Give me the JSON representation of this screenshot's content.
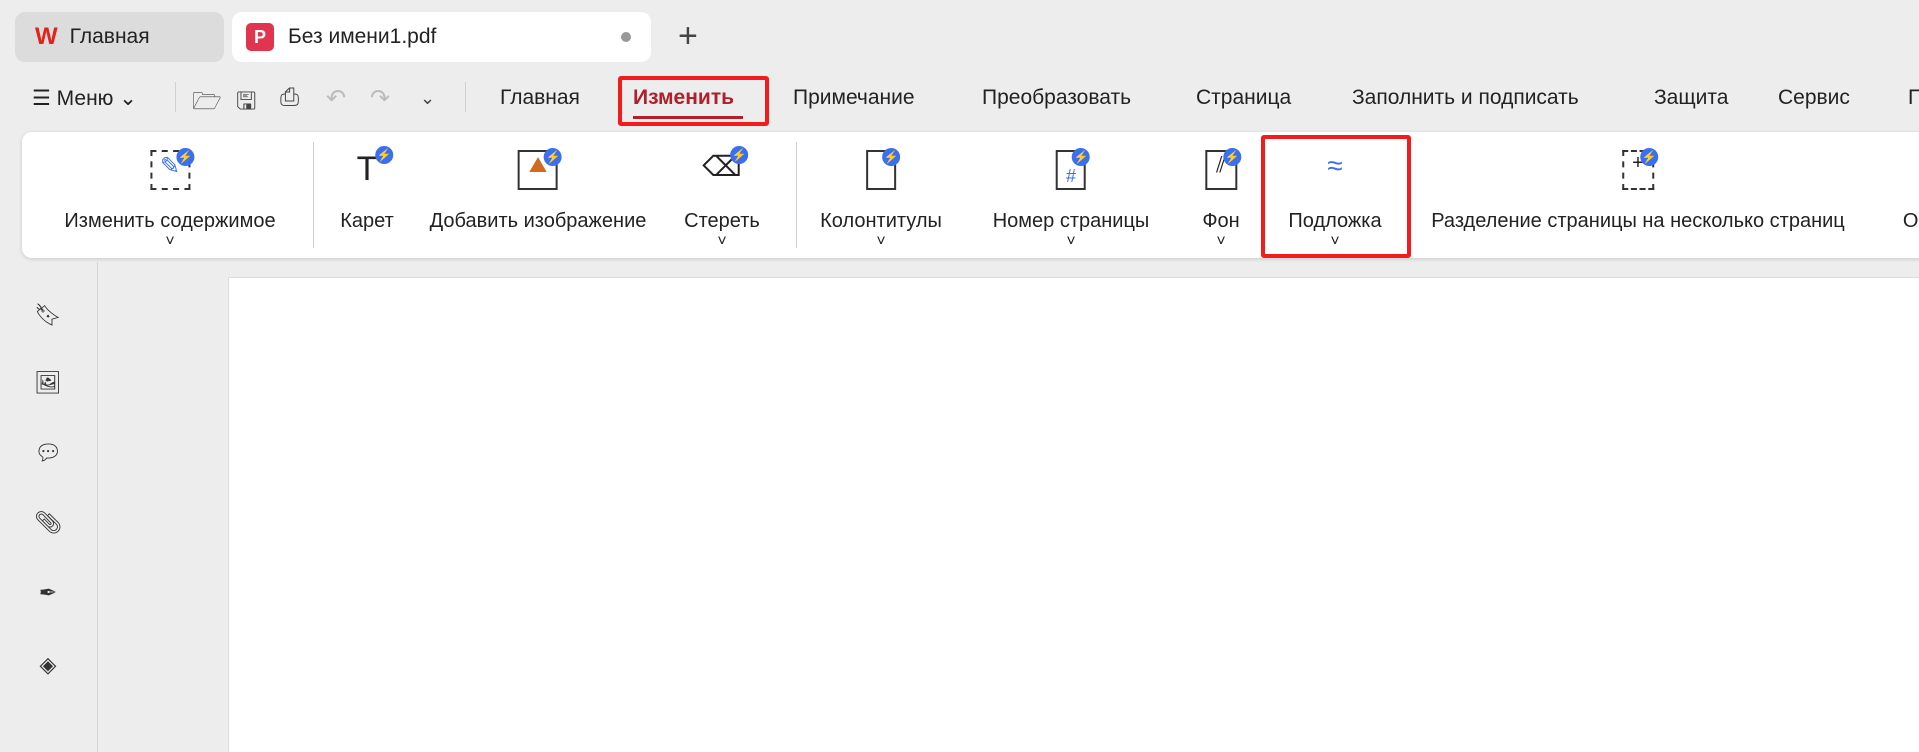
{
  "tabs": [
    {
      "label": "Главная",
      "icon": "wps-logo-icon"
    },
    {
      "label": "Без имени1.pdf",
      "icon": "pdf-icon"
    }
  ],
  "menu": {
    "label": "Меню"
  },
  "nav_tabs": [
    "Главная",
    "Изменить",
    "Примечание",
    "Преобразовать",
    "Страница",
    "Заполнить и подписать",
    "Защита",
    "Сервис",
    "П"
  ],
  "active_tab": "Изменить",
  "ribbon": [
    "Изменить содержимое",
    "Карет",
    "Добавить изображение",
    "Стереть",
    "Колонтитулы",
    "Номер страницы",
    "Фон",
    "Подложка",
    "Разделение страницы на несколько страниц",
    "Обр"
  ],
  "highlight_color": "#f21c1c",
  "accent": "#b0202c"
}
